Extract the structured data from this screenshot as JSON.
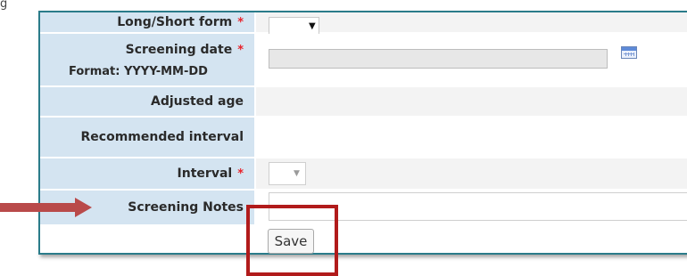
{
  "form": {
    "rows": [
      {
        "label": "Long/Short form",
        "required": true
      },
      {
        "label": "Screening date",
        "sublabel": "Format: YYYY-MM-DD",
        "required": true
      },
      {
        "label": "Adjusted age",
        "required": false
      },
      {
        "label": "Recommended interval",
        "required": false
      },
      {
        "label": "Interval",
        "required": true
      },
      {
        "label": "Screening Notes",
        "required": false
      }
    ],
    "required_marker": "*",
    "save_label": "Save"
  },
  "icons": {
    "date_picker": "calendar-icon",
    "dropdown": "chevron-down-icon",
    "annotation": "arrow-right-icon"
  },
  "colors": {
    "label_bg": "#d4e4f1",
    "border": "#2a7c8a",
    "required": "#e8222a",
    "annotation": "#b11b1b"
  }
}
